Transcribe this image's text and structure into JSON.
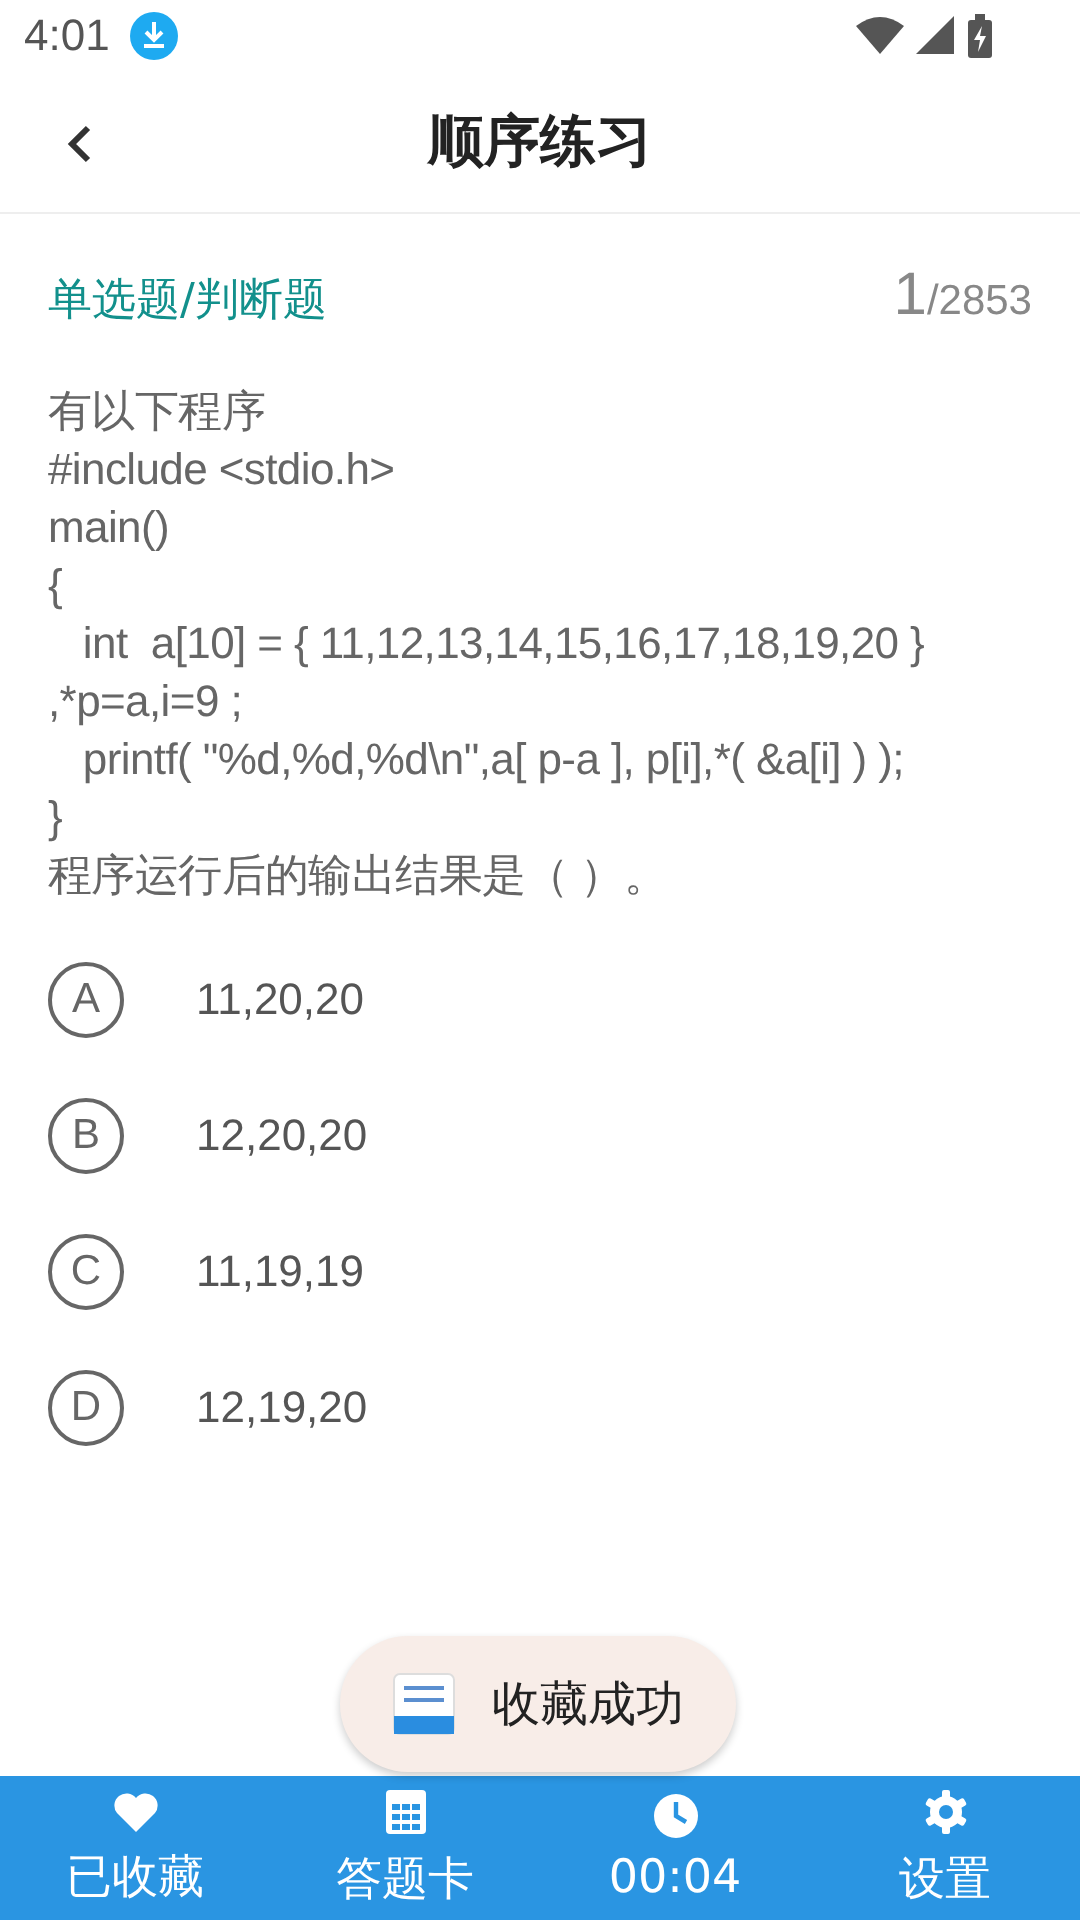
{
  "status_bar": {
    "time": "4:01"
  },
  "header": {
    "title": "顺序练习"
  },
  "question": {
    "type": "单选题/判断题",
    "current": "1",
    "total": "/2853",
    "text": "有以下程序\n#include <stdio.h>\nmain()\n{\n   int  a[10] = { 11,12,13,14,15,16,17,18,19,20 }\n,*p=a,i=9 ;\n   printf( \"%d,%d,%d\\n\",a[ p-a ], p[i],*( &a[i] ) );\n}\n程序运行后的输出结果是（ ）。"
  },
  "options": [
    {
      "letter": "A",
      "text": "11,20,20",
      "selected": false
    },
    {
      "letter": "B",
      "text": "12,20,20",
      "selected": false
    },
    {
      "letter": "C",
      "text": "11,19,19",
      "selected": false
    },
    {
      "letter": "D",
      "text": "12,19,20",
      "selected": false
    }
  ],
  "toast": {
    "text": "收藏成功"
  },
  "bottom_bar": [
    {
      "kind": "heart",
      "label": "已收藏"
    },
    {
      "kind": "grid",
      "label": "答题卡"
    },
    {
      "kind": "clock",
      "label": "00:04"
    },
    {
      "kind": "gear",
      "label": "设置"
    }
  ]
}
